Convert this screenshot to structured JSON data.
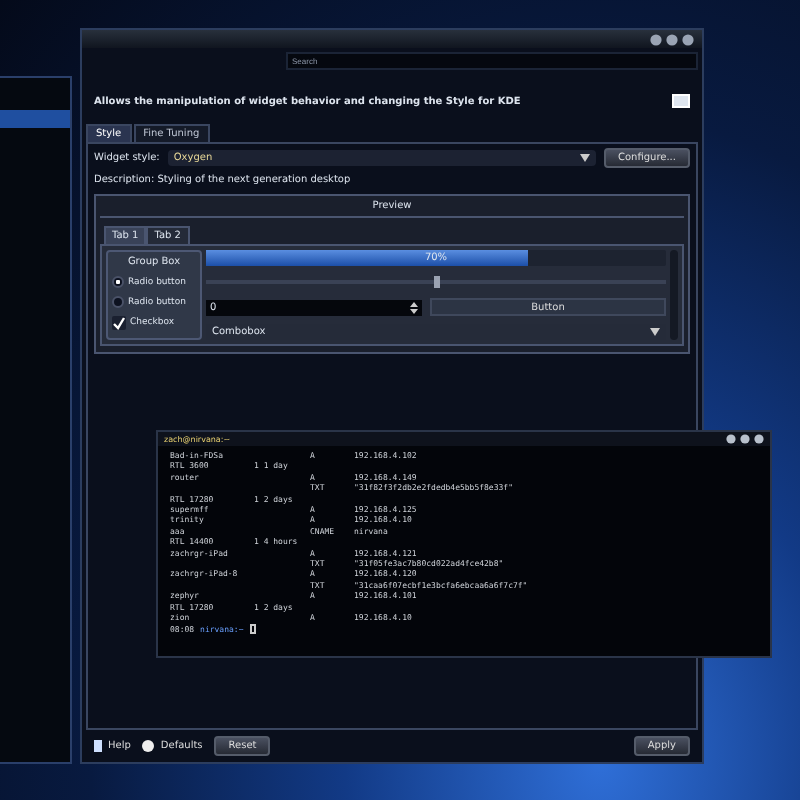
{
  "window": {
    "search": {
      "placeholder": "Search"
    },
    "header": "Allows the manipulation of widget behavior and changing the Style for KDE",
    "tabs": [
      {
        "label": "Style",
        "selected": true
      },
      {
        "label": "Fine Tuning",
        "selected": false
      }
    ],
    "widget_style": {
      "label": "Widget style:",
      "value": "Oxygen",
      "configure": "Configure..."
    },
    "description": "Description: Styling of the next generation desktop",
    "preview": {
      "title": "Preview",
      "tabs": [
        {
          "label": "Tab 1",
          "selected": true
        },
        {
          "label": "Tab 2",
          "selected": false
        }
      ],
      "group_box": {
        "title": "Group Box",
        "items": [
          {
            "kind": "radio",
            "label": "Radio button",
            "selected": true
          },
          {
            "kind": "radio",
            "label": "Radio button",
            "selected": false
          },
          {
            "kind": "checkbox",
            "label": "Checkbox",
            "checked": true
          }
        ]
      },
      "progress": {
        "level": 0.7,
        "text": "70%"
      },
      "slider": {
        "level": 0.5
      },
      "spin_value": "0",
      "button": "Button",
      "combobox": "Combobox"
    },
    "buttons": [
      {
        "kind": "help",
        "label": "Help"
      },
      {
        "kind": "defaults",
        "label": "Defaults"
      },
      {
        "kind": "reset",
        "label": "Reset"
      },
      {
        "kind": "apply",
        "label": "Apply"
      }
    ]
  },
  "terminal": {
    "title": "zach@nirvana:~",
    "lines": [
      {
        "c1": "Bad-in-FDSa",
        "c3": "A",
        "c4": "192.168.4.102"
      },
      {
        "c1": "RTL 3600",
        "c2": "1 1 day"
      },
      {
        "c1": "router",
        "c3": "A",
        "c4": "192.168.4.149"
      },
      {
        "c3": "TXT",
        "c4": "\"31f82f3f2db2e2fdedb4e5bb5f8e33f\""
      },
      {
        "c1": "RTL 17280",
        "c2": "1 2 days"
      },
      {
        "c1": "supermff",
        "c3": "A",
        "c4": "192.168.4.125"
      },
      {
        "c1": "trinity",
        "c3": "A",
        "c4": "192.168.4.10"
      },
      {
        "c1": "aaa",
        "c3": "CNAME",
        "c4": "nirvana"
      },
      {
        "c1": "RTL 14400",
        "c2": "1 4 hours"
      },
      {
        "c1": "zachrgr-iPad",
        "c3": "A",
        "c4": "192.168.4.121"
      },
      {
        "c3": "TXT",
        "c4": "\"31f05fe3ac7b80cd022ad4fce42b8\""
      },
      {
        "c1": "zachrgr-iPad-8",
        "c3": "A",
        "c4": "192.168.4.120"
      },
      {
        "c3": "TXT",
        "c4": "\"31caa6f07ecbf1e3bcfa6ebcaa6a6f7c7f\""
      },
      {
        "c1": "zephyr",
        "c3": "A",
        "c4": "192.168.4.101"
      },
      {
        "c1": "RTL 17280",
        "c2": "1 2 days"
      },
      {
        "c1": "zion",
        "c3": "A",
        "c4": "192.168.4.10"
      }
    ],
    "prompt_time": "08:08",
    "prompt": "nirvana:~"
  }
}
